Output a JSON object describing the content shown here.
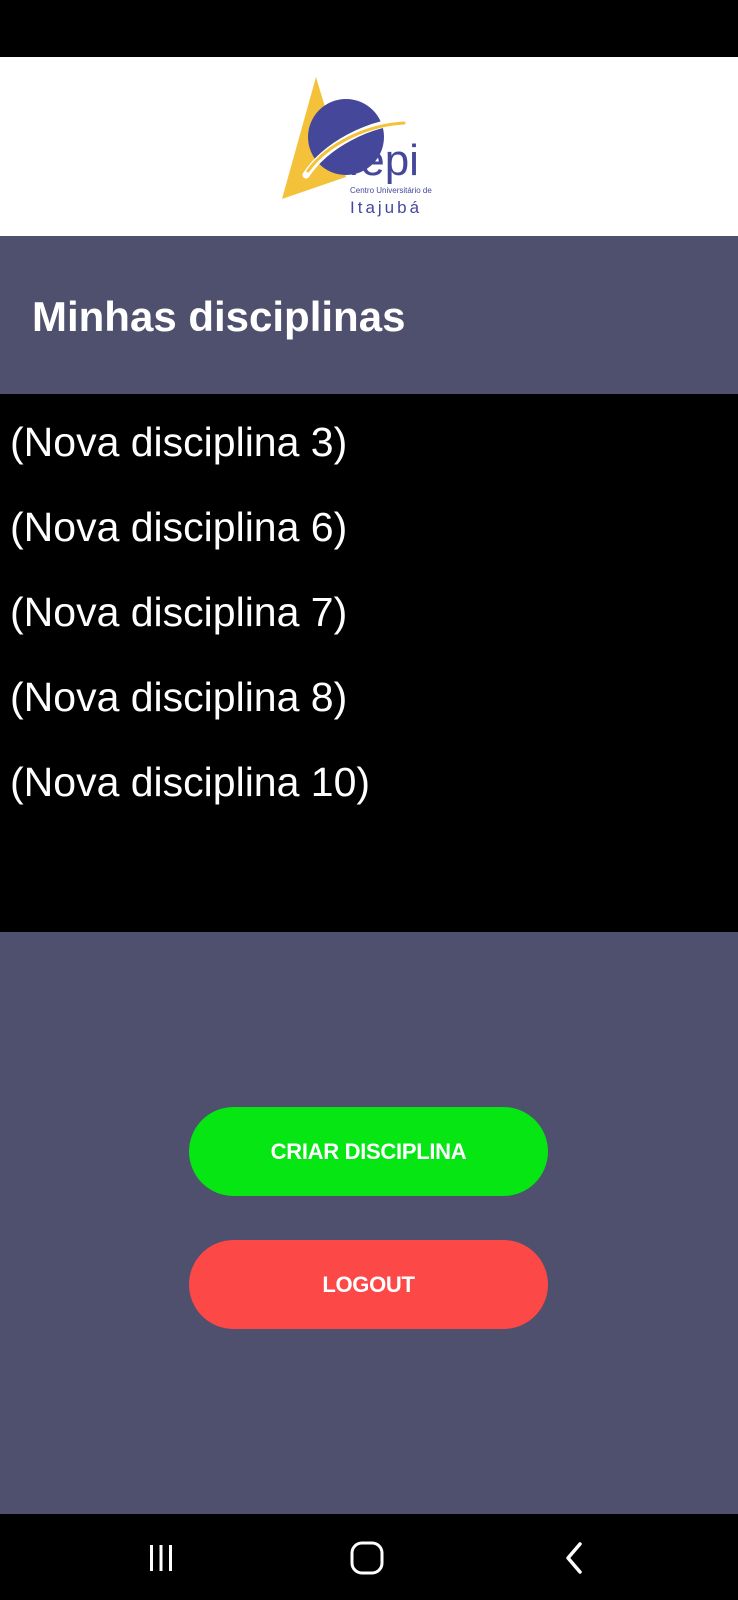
{
  "header": {
    "logo": {
      "name": "fepi",
      "subtitle": "Centro Universitário de",
      "city": "Itajubá",
      "colors": {
        "triangle": "#f3c23a",
        "globe": "#45489a",
        "text": "#45489a"
      }
    }
  },
  "page": {
    "title": "Minhas disciplinas"
  },
  "disciplines": [
    {
      "label": "(Nova disciplina 3)"
    },
    {
      "label": "(Nova disciplina 6)"
    },
    {
      "label": "(Nova disciplina 7)"
    },
    {
      "label": "(Nova disciplina 8)"
    },
    {
      "label": "(Nova disciplina 10)"
    }
  ],
  "actions": {
    "create_label": "CRIAR DISCIPLINA",
    "logout_label": "LOGOUT"
  },
  "navigation": {
    "recent_icon": "recent-apps-icon",
    "home_icon": "home-icon",
    "back_icon": "back-icon"
  },
  "theme": {
    "panel": "#4f506e",
    "create_button": "#05e612",
    "logout_button": "#fd4848",
    "list_background": "#000000"
  }
}
